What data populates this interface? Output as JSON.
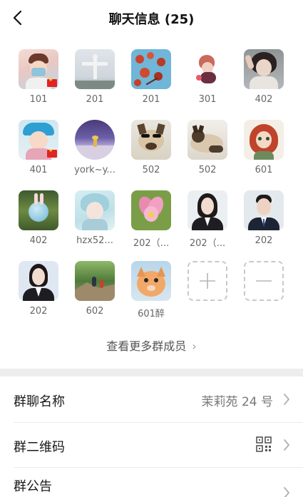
{
  "header": {
    "title": "聊天信息 (25)"
  },
  "members": [
    {
      "name": "101"
    },
    {
      "name": "201"
    },
    {
      "name": "201"
    },
    {
      "name": "301"
    },
    {
      "name": "402"
    },
    {
      "name": "401"
    },
    {
      "name": "york~y..."
    },
    {
      "name": "502"
    },
    {
      "name": "502"
    },
    {
      "name": "601"
    },
    {
      "name": "402"
    },
    {
      "name": "hzx52..."
    },
    {
      "name": "202（..."
    },
    {
      "name": "202（..."
    },
    {
      "name": "202"
    },
    {
      "name": "202"
    },
    {
      "name": "602"
    },
    {
      "name": "601醉"
    }
  ],
  "more_members": {
    "label": "查看更多群成员"
  },
  "settings": {
    "group_name": {
      "label": "群聊名称",
      "value": "茉莉苑 24 号"
    },
    "qr_code": {
      "label": "群二维码"
    },
    "notice": {
      "label": "群公告"
    }
  }
}
